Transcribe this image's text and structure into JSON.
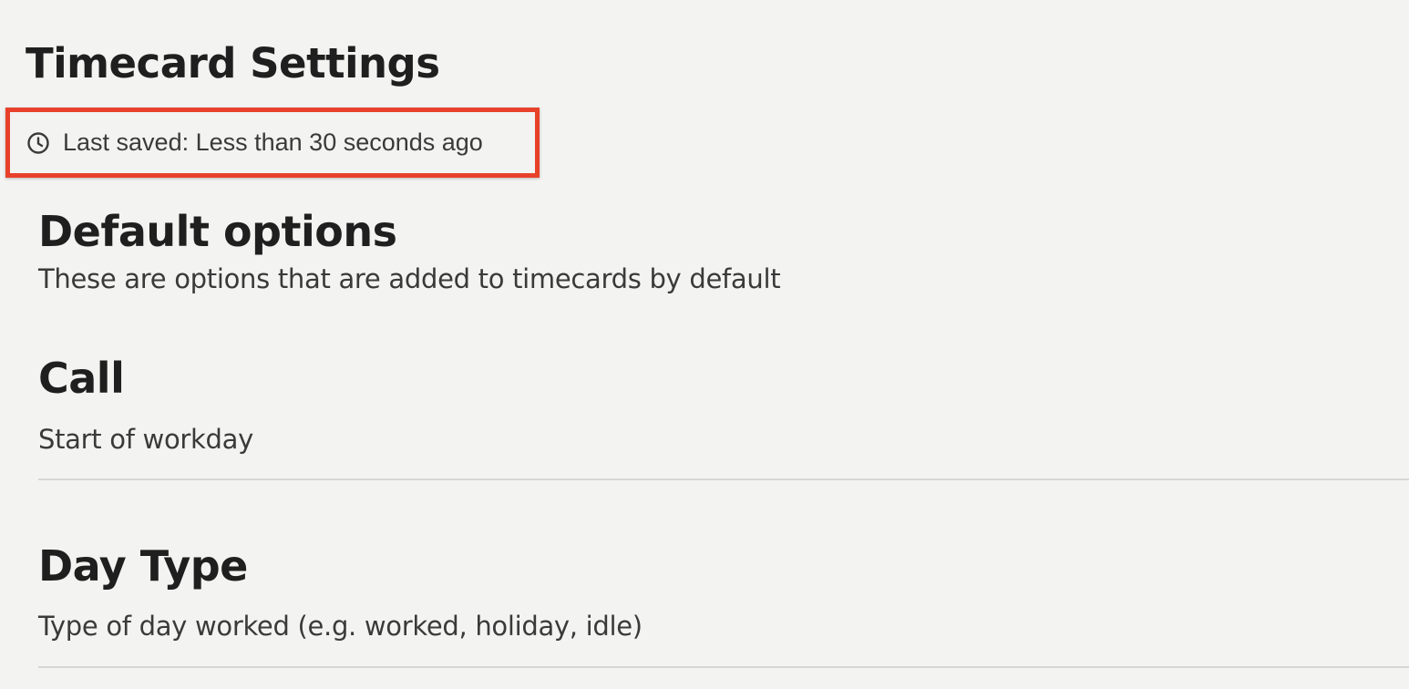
{
  "page": {
    "title": "Timecard Settings"
  },
  "saved_status": {
    "icon": "clock-icon",
    "text": "Last saved: Less than 30 seconds ago",
    "highlight_color": "#e8412b"
  },
  "default_options": {
    "heading": "Default options",
    "description": "These are options that are added to timecards by default"
  },
  "options": [
    {
      "name": "Call",
      "description": "Start of workday"
    },
    {
      "name": "Day Type",
      "description": "Type of day worked (e.g. worked, holiday, idle)"
    }
  ]
}
